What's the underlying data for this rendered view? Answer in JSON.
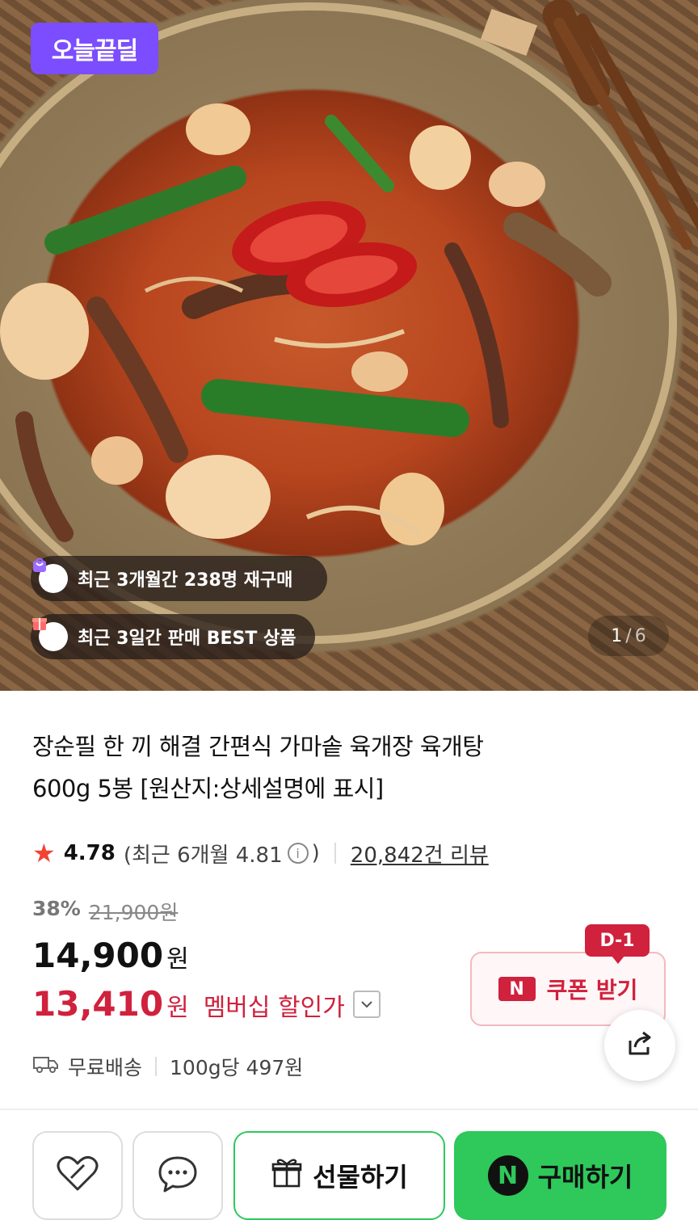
{
  "hero": {
    "deal_badge": "오늘끝딜",
    "pill_repurchase": "최근 3개월간 238명 재구매",
    "pill_best": "최근 3일간 판매 BEST 상품",
    "image_index": "1",
    "image_separator": "/",
    "image_total": "6"
  },
  "product": {
    "title_line1": "장순필 한 끼 해결 간편식 가마솥 육개장 육개탕",
    "title_line2": "600g 5봉 [원산지:상세설명에 표시]"
  },
  "rating": {
    "score": "4.78",
    "recent_prefix": "(최근 6개월 4.81",
    "recent_suffix": ")",
    "reviews": "20,842건 리뷰"
  },
  "price": {
    "discount_pct": "38%",
    "original": "21,900원",
    "sale": "14,900",
    "sale_unit": "원",
    "member": "13,410",
    "member_unit": "원",
    "member_label": "멤버십 할인가"
  },
  "coupon": {
    "dday": "D-1",
    "badge": "N",
    "label": "쿠폰 받기"
  },
  "delivery": {
    "shipping": "무료배송",
    "unit_price": "100g당 497원"
  },
  "actions": {
    "gift": "선물하기",
    "buy_badge": "N",
    "buy": "구매하기"
  },
  "colors": {
    "deal_purple": "#7b4dff",
    "member_red": "#d0213d",
    "naver_green": "#2fc85b",
    "star": "#f04535"
  }
}
